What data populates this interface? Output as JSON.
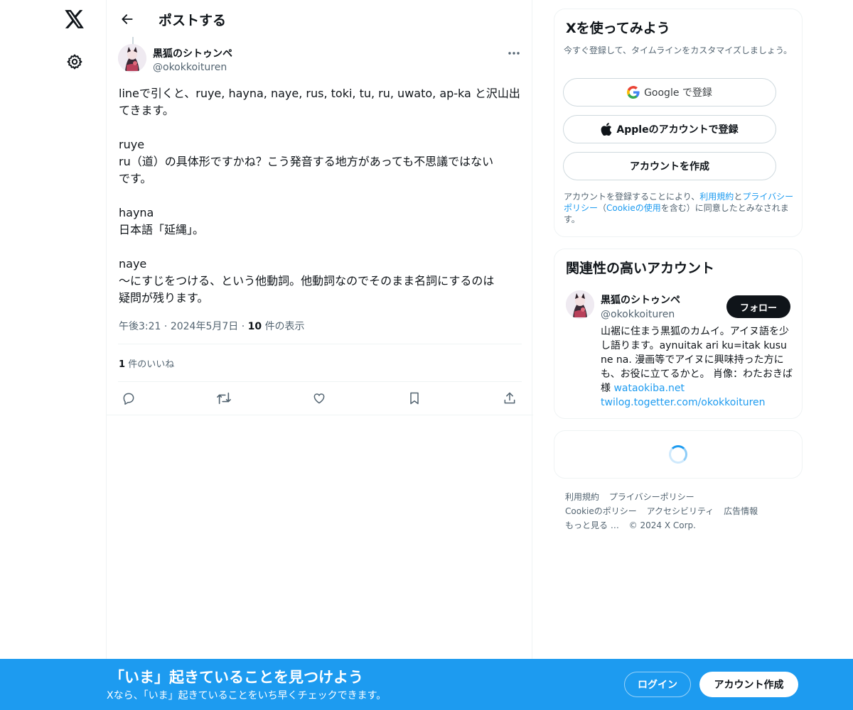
{
  "header": {
    "title": "ポストする"
  },
  "post": {
    "author_name": "黒狐のシトゥンペ",
    "author_handle": "@okokkoituren",
    "paragraphs": [
      "lineで引くと、ruye, hayna, naye, rus, toki, tu, ru, uwato, ap-ka と沢山出\nてきます。",
      "ruye\nru（道）の具体形ですかね？こう発音する地方があっても不思議ではない\nです。",
      "hayna\n日本語「延縄」。",
      "naye\n〜にすじをつける、という他動詞。他動詞なのでそのまま名詞にするのは\n疑問が残ります。"
    ],
    "time": "午後3:21",
    "date": "2024年5月7日",
    "separator": "·",
    "views_count": "10",
    "views_label": "件の表示",
    "likes_count": "1",
    "likes_label": "件のいいね"
  },
  "signup_card": {
    "title": "Xを使ってみよう",
    "subtitle": "今すぐ登録して、タイムラインをカスタマイズしましょう。",
    "google_label": "Google で登録",
    "apple_label": "Appleのアカウントで登録",
    "create_label": "アカウントを作成",
    "terms_prefix": "アカウントを登録することにより、",
    "terms_link": "利用規約",
    "terms_and": "と",
    "privacy_link": "プライバシーポリシー",
    "terms_paren_open": "（",
    "cookie_link": "Cookieの使用",
    "terms_suffix": "を含む）に同意したとみなされます。"
  },
  "related": {
    "title": "関連性の高いアカウント",
    "name": "黒狐のシトゥンペ",
    "handle": "@okokkoituren",
    "follow_label": "フォロー",
    "bio": "山裾に住まう黒狐のカムイ。アイヌ語を少し語ります。aynuitak ari ku=itak kusu ne na. 漫画等でアイヌに興味持った方にも、お役に立てるかと。 肖像：わたおきば様 ",
    "link1": "wataokiba.net",
    "link2": "twilog.togetter.com/okokkoituren"
  },
  "footer": {
    "links": [
      "利用規約",
      "プライバシーポリシー",
      "Cookieのポリシー",
      "アクセシビリティ",
      "広告情報",
      "もっと見る …",
      "© 2024 X Corp."
    ]
  },
  "banner": {
    "title": "「いま」起きていることを見つけよう",
    "subtitle": "Xなら、「いま」起きていることをいち早くチェックできます。",
    "login_label": "ログイン",
    "signup_label": "アカウント作成"
  },
  "colors": {
    "accent": "#1d9bf0",
    "text": "#0f1419",
    "muted": "#536471"
  }
}
